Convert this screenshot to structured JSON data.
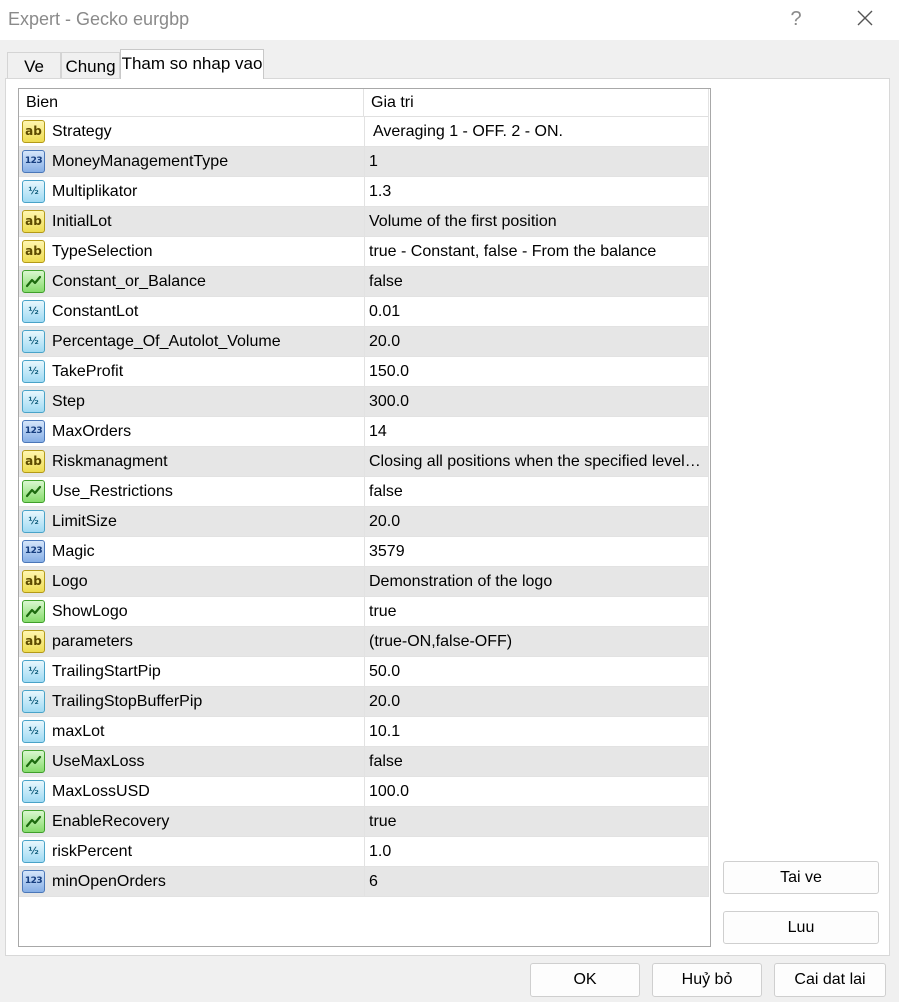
{
  "window": {
    "title": "Expert - Gecko eurgbp",
    "help": "?"
  },
  "tabs": [
    {
      "label": "Ve"
    },
    {
      "label": "Chung"
    },
    {
      "label": "Tham so nhap vao"
    }
  ],
  "grid": {
    "col_name": "Bien",
    "col_value": "Gia tri",
    "rows": [
      {
        "type": "str",
        "icon": "string-type-icon",
        "name": "Strategy",
        "value": "Averaging 1 - OFF. 2 - ON."
      },
      {
        "type": "int",
        "icon": "integer-type-icon",
        "name": "MoneyManagementType",
        "value": "1"
      },
      {
        "type": "dbl",
        "icon": "double-type-icon",
        "name": "Multiplikator",
        "value": "1.3"
      },
      {
        "type": "str",
        "icon": "string-type-icon",
        "name": "InitialLot",
        "value": "Volume of the first position"
      },
      {
        "type": "str",
        "icon": "string-type-icon",
        "name": "TypeSelection",
        "value": "true - Constant, false - From the balance"
      },
      {
        "type": "bool",
        "icon": "boolean-type-icon",
        "name": "Constant_or_Balance",
        "value": "false"
      },
      {
        "type": "dbl",
        "icon": "double-type-icon",
        "name": "ConstantLot",
        "value": "0.01"
      },
      {
        "type": "dbl",
        "icon": "double-type-icon",
        "name": "Percentage_Of_Autolot_Volume",
        "value": "20.0"
      },
      {
        "type": "dbl",
        "icon": "double-type-icon",
        "name": "TakeProfit",
        "value": "150.0"
      },
      {
        "type": "dbl",
        "icon": "double-type-icon",
        "name": "Step",
        "value": "300.0"
      },
      {
        "type": "int",
        "icon": "integer-type-icon",
        "name": "MaxOrders",
        "value": "14"
      },
      {
        "type": "str",
        "icon": "string-type-icon",
        "name": "Riskmanagment",
        "value": "Closing all positions when the specified level i..."
      },
      {
        "type": "bool",
        "icon": "boolean-type-icon",
        "name": "Use_Restrictions",
        "value": "false"
      },
      {
        "type": "dbl",
        "icon": "double-type-icon",
        "name": "LimitSize",
        "value": "20.0"
      },
      {
        "type": "int",
        "icon": "integer-type-icon",
        "name": "Magic",
        "value": "3579"
      },
      {
        "type": "str",
        "icon": "string-type-icon",
        "name": "Logo",
        "value": "Demonstration of the logo"
      },
      {
        "type": "bool",
        "icon": "boolean-type-icon",
        "name": "ShowLogo",
        "value": "true"
      },
      {
        "type": "str",
        "icon": "string-type-icon",
        "name": "parameters",
        "value": "(true-ON,false-OFF)"
      },
      {
        "type": "dbl",
        "icon": "double-type-icon",
        "name": "TrailingStartPip",
        "value": "50.0"
      },
      {
        "type": "dbl",
        "icon": "double-type-icon",
        "name": "TrailingStopBufferPip",
        "value": "20.0"
      },
      {
        "type": "dbl",
        "icon": "double-type-icon",
        "name": "maxLot",
        "value": "10.1"
      },
      {
        "type": "bool",
        "icon": "boolean-type-icon",
        "name": "UseMaxLoss",
        "value": "false"
      },
      {
        "type": "dbl",
        "icon": "double-type-icon",
        "name": "MaxLossUSD",
        "value": "100.0"
      },
      {
        "type": "bool",
        "icon": "boolean-type-icon",
        "name": "EnableRecovery",
        "value": "true"
      },
      {
        "type": "dbl",
        "icon": "double-type-icon",
        "name": "riskPercent",
        "value": "1.0"
      },
      {
        "type": "int",
        "icon": "integer-type-icon",
        "name": "minOpenOrders",
        "value": "6"
      }
    ]
  },
  "icon_glyphs": {
    "str": "ab",
    "int": "123",
    "dbl": "½"
  },
  "side_buttons": {
    "load": "Tai ve",
    "save": "Luu"
  },
  "footer_buttons": {
    "ok": "OK",
    "cancel": "Huỷ bỏ",
    "reset": "Cai dat lai"
  }
}
